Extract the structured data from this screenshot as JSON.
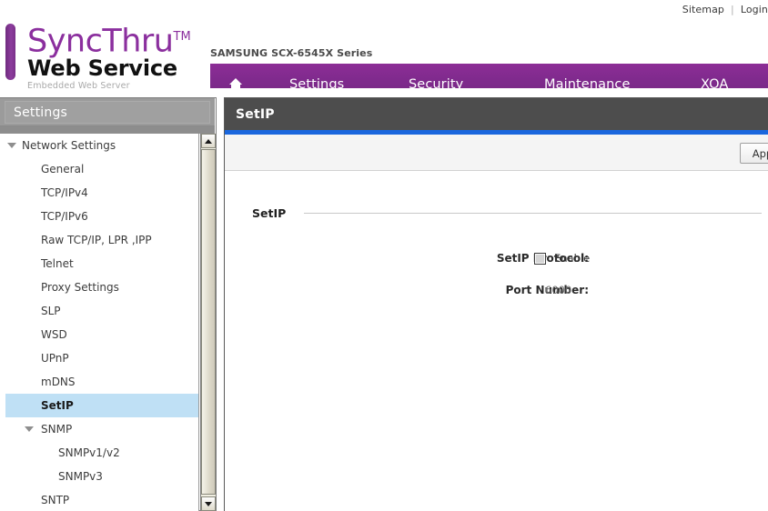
{
  "topbar": {
    "sitemap_label": "Sitemap",
    "separator": "|",
    "login_label": "Login"
  },
  "brand": {
    "line1": "SyncThru",
    "trademark": "TM",
    "line2": "Web Service",
    "line3": "Embedded Web Server",
    "accent_color": "#8b2f9e"
  },
  "device": {
    "model_name": "SAMSUNG SCX-6545X Series"
  },
  "nav": {
    "background_color": "#7e2a8c",
    "home_icon": "home-icon",
    "items": [
      {
        "label": "Settings"
      },
      {
        "label": "Security"
      },
      {
        "label": "Maintenance"
      },
      {
        "label": "XOA"
      }
    ]
  },
  "sidebar": {
    "title": "Settings",
    "header_color": "#9b9b9b",
    "selected_color": "#bfe0f5",
    "items": [
      {
        "label": "Network Settings",
        "level": 0,
        "expandable": true,
        "selected": false
      },
      {
        "label": "General",
        "level": 1,
        "expandable": false,
        "selected": false
      },
      {
        "label": "TCP/IPv4",
        "level": 1,
        "expandable": false,
        "selected": false
      },
      {
        "label": "TCP/IPv6",
        "level": 1,
        "expandable": false,
        "selected": false
      },
      {
        "label": "Raw TCP/IP, LPR ,IPP",
        "level": 1,
        "expandable": false,
        "selected": false
      },
      {
        "label": "Telnet",
        "level": 1,
        "expandable": false,
        "selected": false
      },
      {
        "label": "Proxy Settings",
        "level": 1,
        "expandable": false,
        "selected": false
      },
      {
        "label": "SLP",
        "level": 1,
        "expandable": false,
        "selected": false
      },
      {
        "label": "WSD",
        "level": 1,
        "expandable": false,
        "selected": false
      },
      {
        "label": "UPnP",
        "level": 1,
        "expandable": false,
        "selected": false
      },
      {
        "label": "mDNS",
        "level": 1,
        "expandable": false,
        "selected": false
      },
      {
        "label": "SetIP",
        "level": 1,
        "expandable": false,
        "selected": true
      },
      {
        "label": "SNMP",
        "level": 1,
        "expandable": true,
        "selected": false
      },
      {
        "label": "SNMPv1/v2",
        "level": 2,
        "expandable": false,
        "selected": false
      },
      {
        "label": "SNMPv3",
        "level": 2,
        "expandable": false,
        "selected": false
      },
      {
        "label": "SNTP",
        "level": 1,
        "expandable": false,
        "selected": false
      }
    ]
  },
  "main": {
    "header_title": "SetIP",
    "accent_bar_color": "#1a66dd",
    "apply_label": "Apply",
    "section_title": "SetIP",
    "fields": [
      {
        "label": "SetIP Protocol:",
        "control": "checkbox",
        "checkbox_label": "Enable",
        "checked": false
      },
      {
        "label": "Port Number:",
        "control": "text",
        "value": "6000"
      }
    ]
  }
}
